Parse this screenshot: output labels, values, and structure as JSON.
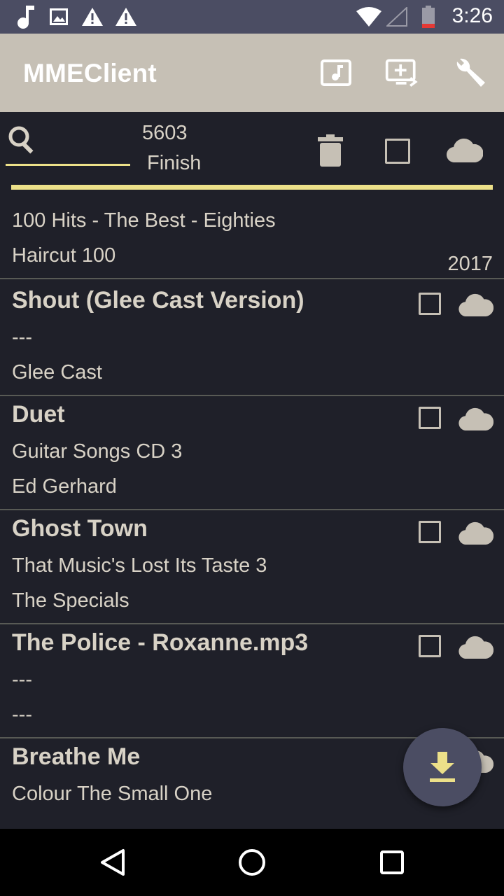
{
  "statusbar": {
    "time": "3:26"
  },
  "app": {
    "title": "MMEClient"
  },
  "toolbar": {
    "count": "5603",
    "status": "Finish",
    "progress": 1.0
  },
  "rows": [
    {
      "title": "",
      "album": "100 Hits - The Best - Eighties",
      "artist": "Haircut 100",
      "year": "2017"
    },
    {
      "title": "Shout (Glee Cast Version)",
      "album": "---",
      "artist": "Glee Cast",
      "year": ""
    },
    {
      "title": "Duet",
      "album": "Guitar Songs CD 3",
      "artist": "Ed Gerhard",
      "year": ""
    },
    {
      "title": "Ghost Town",
      "album": "That Music's Lost Its Taste 3",
      "artist": "The Specials",
      "year": ""
    },
    {
      "title": "The Police - Roxanne.mp3",
      "album": "---",
      "artist": "---",
      "year": ""
    },
    {
      "title": "Breathe Me",
      "album": "Colour The Small One",
      "artist": "",
      "year": ""
    }
  ],
  "colors": {
    "accent": "#ece089",
    "appbar": "#c6c0b5",
    "background": "#1f2029",
    "statusbar": "#4b4d63"
  }
}
